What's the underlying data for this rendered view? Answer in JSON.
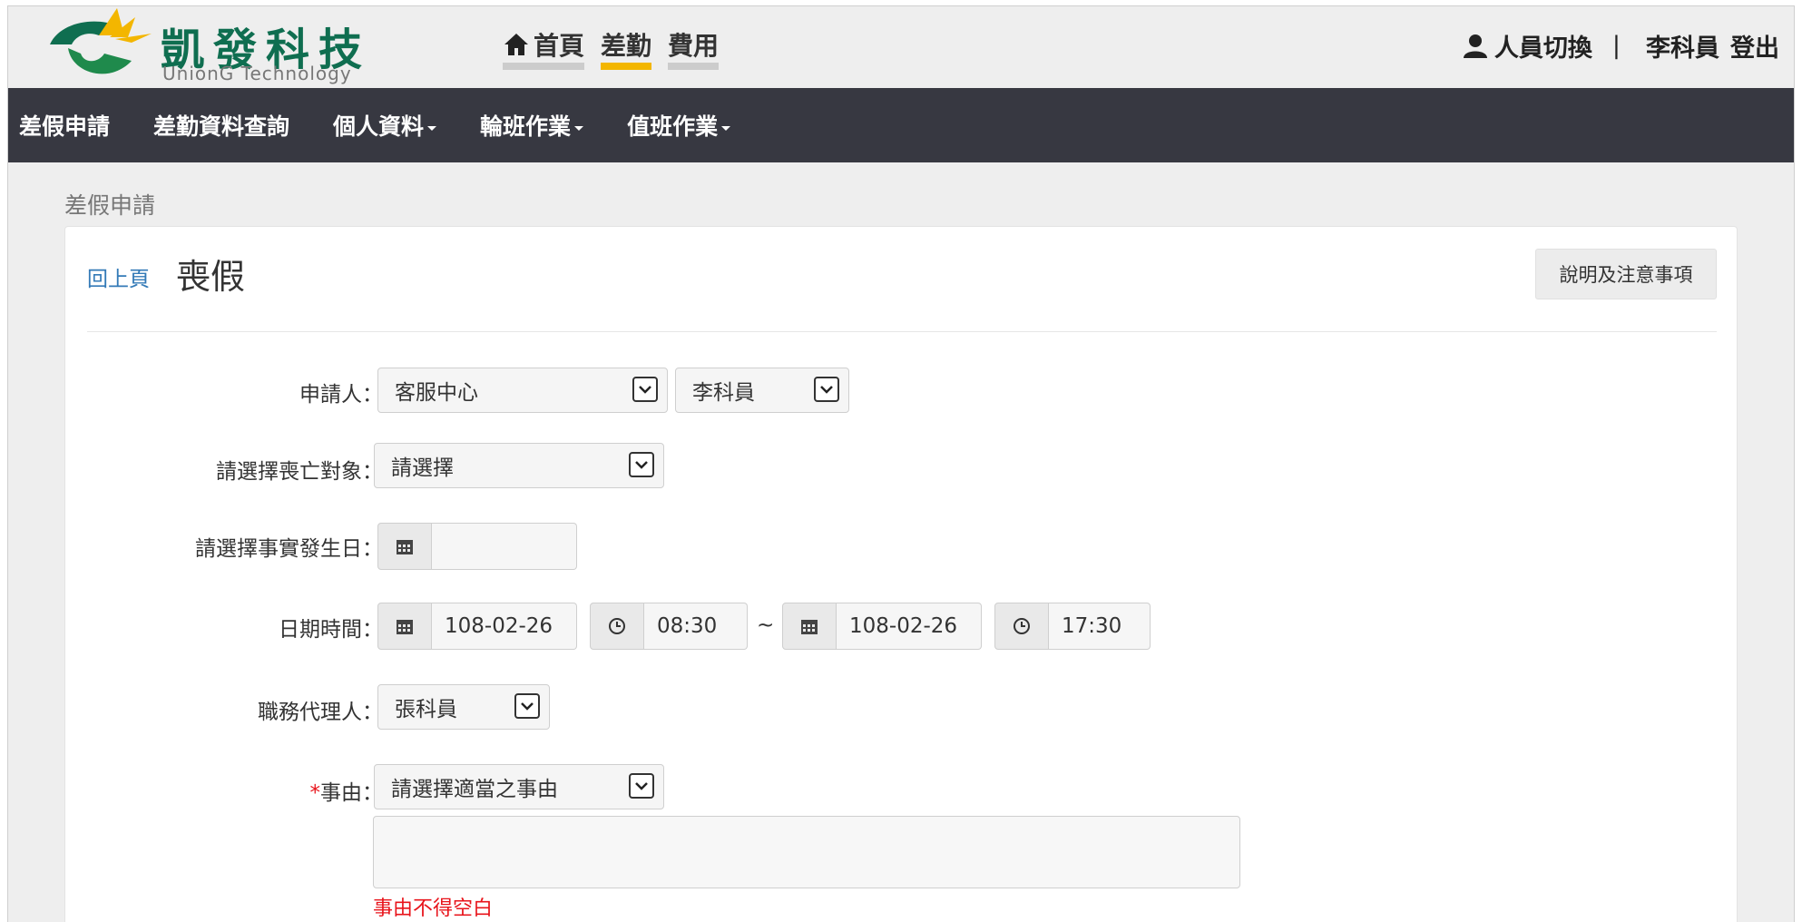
{
  "brand": {
    "title": "凱發科技",
    "subtitle": "UnionG Technology",
    "colors": {
      "green": "#0f6e50",
      "yellow": "#f3b600"
    }
  },
  "topnav": {
    "items": [
      {
        "label": "首頁",
        "icon": "home-icon",
        "active": false
      },
      {
        "label": "差勤",
        "active": true
      },
      {
        "label": "費用",
        "active": false
      }
    ]
  },
  "user": {
    "switch_label": "人員切換",
    "separator": "|",
    "name": "李科員",
    "logout_label": "登出"
  },
  "mainnav": {
    "items": [
      {
        "label": "差假申請",
        "dropdown": false
      },
      {
        "label": "差勤資料查詢",
        "dropdown": false
      },
      {
        "label": "個人資料",
        "dropdown": true
      },
      {
        "label": "輪班作業",
        "dropdown": true
      },
      {
        "label": "值班作業",
        "dropdown": true
      }
    ]
  },
  "breadcrumb": "差假申請",
  "panel": {
    "back_label": "回上頁",
    "title": "喪假",
    "help_button": "說明及注意事項"
  },
  "form": {
    "applicant": {
      "label": "申請人：",
      "department": "客服中心",
      "person": "李科員"
    },
    "deceased": {
      "label": "請選擇喪亡對象：",
      "value": "請選擇"
    },
    "event_date": {
      "label": "請選擇事實發生日：",
      "value": ""
    },
    "period": {
      "label": "日期時間：",
      "start_date": "108-02-26",
      "start_time": "08:30",
      "separator": "~",
      "end_date": "108-02-26",
      "end_time": "17:30"
    },
    "agent": {
      "label": "職務代理人：",
      "value": "張科員"
    },
    "reason": {
      "required_mark": "*",
      "label": "事由：",
      "value": "請選擇適當之事由",
      "error": "事由不得空白"
    }
  }
}
